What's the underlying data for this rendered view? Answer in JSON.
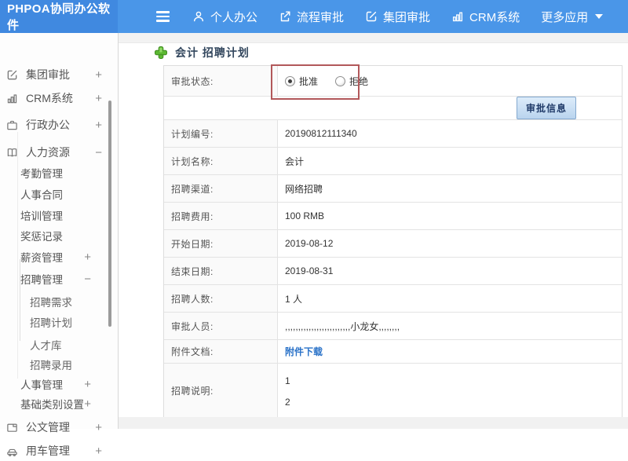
{
  "topbar": {
    "logo": "PHPOA协同办公软件",
    "nav": [
      {
        "label": "个人办公",
        "icon": "user-icon"
      },
      {
        "label": "流程审批",
        "icon": "workflow-icon"
      },
      {
        "label": "集团审批",
        "icon": "edit-icon"
      },
      {
        "label": "CRM系统",
        "icon": "bar-chart-icon"
      },
      {
        "label": "更多应用",
        "icon": "caret-down-icon"
      }
    ]
  },
  "sidebar": {
    "items": [
      {
        "label": "集团审批",
        "level": 1,
        "icon": "edit-icon",
        "expand": "+"
      },
      {
        "label": "CRM系统",
        "level": 1,
        "icon": "bar-chart-icon",
        "expand": "+"
      },
      {
        "label": "行政办公",
        "level": 1,
        "icon": "briefcase-icon",
        "expand": "+"
      },
      {
        "label": "人力资源",
        "level": 1,
        "icon": "book-icon",
        "expand": "−"
      },
      {
        "label": "考勤管理",
        "level": 2
      },
      {
        "label": "人事合同",
        "level": 2
      },
      {
        "label": "培训管理",
        "level": 2
      },
      {
        "label": "奖惩记录",
        "level": 2
      },
      {
        "label": "薪资管理",
        "level": 2,
        "expand": "+"
      },
      {
        "label": "招聘管理",
        "level": 2,
        "expand": "−"
      },
      {
        "label": "招聘需求",
        "level": 3
      },
      {
        "label": "招聘计划",
        "level": 3
      },
      {
        "label": "人才库",
        "level": 3
      },
      {
        "label": "招聘录用",
        "level": 3
      },
      {
        "label": "人事管理",
        "level": 2,
        "expand": "+"
      },
      {
        "label": "基础类别设置",
        "level": 2,
        "expand": "+"
      },
      {
        "label": "公文管理",
        "level": 1,
        "icon": "document-icon",
        "expand": "+"
      },
      {
        "label": "用车管理",
        "level": 1,
        "icon": "car-icon",
        "expand": "+"
      }
    ]
  },
  "main": {
    "title": "会计 招聘计划",
    "approval": {
      "label": "审批状态:",
      "options": [
        {
          "label": "批准",
          "selected": true
        },
        {
          "label": "拒绝",
          "selected": false
        }
      ]
    },
    "approve_button": "审批信息",
    "fields": [
      {
        "label": "计划编号:",
        "value": "20190812111340"
      },
      {
        "label": "计划名称:",
        "value": "会计"
      },
      {
        "label": "招聘渠道:",
        "value": "网络招聘"
      },
      {
        "label": "招聘费用:",
        "value": "100 RMB"
      },
      {
        "label": "开始日期:",
        "value": "2019-08-12"
      },
      {
        "label": "结束日期:",
        "value": "2019-08-31"
      },
      {
        "label": "招聘人数:",
        "value": "1 人"
      },
      {
        "label": "审批人员:",
        "value": ",,,,,,,,,,,,,,,,,,,,,,,,,小龙女,,,,,,,,"
      },
      {
        "label": "附件文档:",
        "value": "附件下载"
      },
      {
        "label": "招聘说明:",
        "value_lines": [
          "1",
          "2"
        ]
      }
    ]
  },
  "colors": {
    "topbar_blue": "#4a96e8",
    "logo_blue": "#4089e0",
    "annotation_red": "#b2585a",
    "link_blue": "#2a72c8",
    "button_text": "#1f3a68"
  }
}
